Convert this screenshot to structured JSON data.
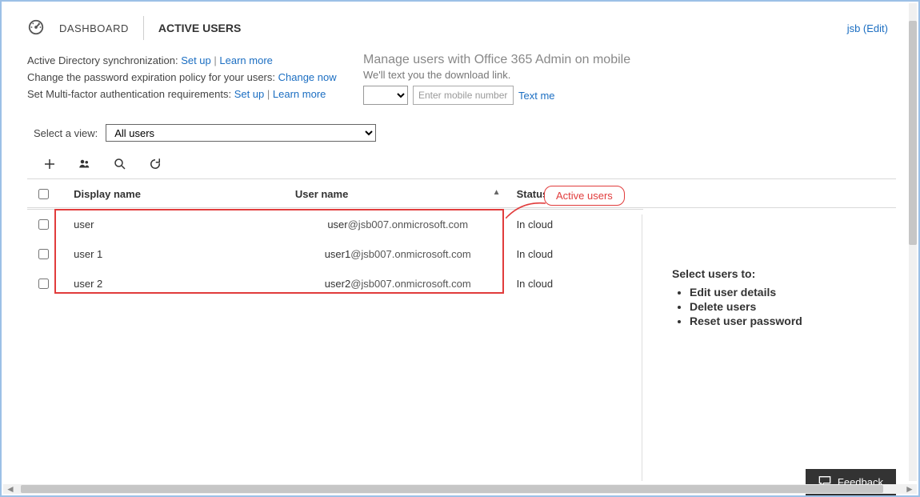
{
  "header": {
    "dashboard_label": "DASHBOARD",
    "page_title": "ACTIVE USERS",
    "user_link": "jsb (Edit)"
  },
  "messages": {
    "ad_sync_label": "Active Directory synchronization: ",
    "ad_sync_setup": "Set up",
    "ad_sync_learn": "Learn more",
    "pwd_policy_label": "Change the password expiration policy for your users: ",
    "pwd_policy_link": "Change now",
    "mfa_label": "Set Multi-factor authentication requirements: ",
    "mfa_setup": "Set up",
    "mfa_learn": "Learn more"
  },
  "mobile": {
    "heading": "Manage users with Office 365 Admin on mobile",
    "subtext": "We'll text you the download link.",
    "placeholder": "Enter mobile number",
    "text_me": "Text me"
  },
  "view": {
    "label": "Select a view:",
    "selected": "All users"
  },
  "columns": {
    "display_name": "Display name",
    "user_name": "User name",
    "status": "Status"
  },
  "rows": [
    {
      "display": "user",
      "user_prefix": "user",
      "user_suffix": "@jsb007.onmicrosoft.com",
      "status": "In cloud"
    },
    {
      "display": "user 1",
      "user_prefix": "user1",
      "user_suffix": "@jsb007.onmicrosoft.com",
      "status": "In cloud"
    },
    {
      "display": "user 2",
      "user_prefix": "user2",
      "user_suffix": "@jsb007.onmicrosoft.com",
      "status": "In cloud"
    }
  ],
  "callout": "Active users",
  "side": {
    "heading": "Select users to:",
    "items": [
      "Edit user details",
      "Delete users",
      "Reset user password"
    ]
  },
  "feedback": "Feedback"
}
